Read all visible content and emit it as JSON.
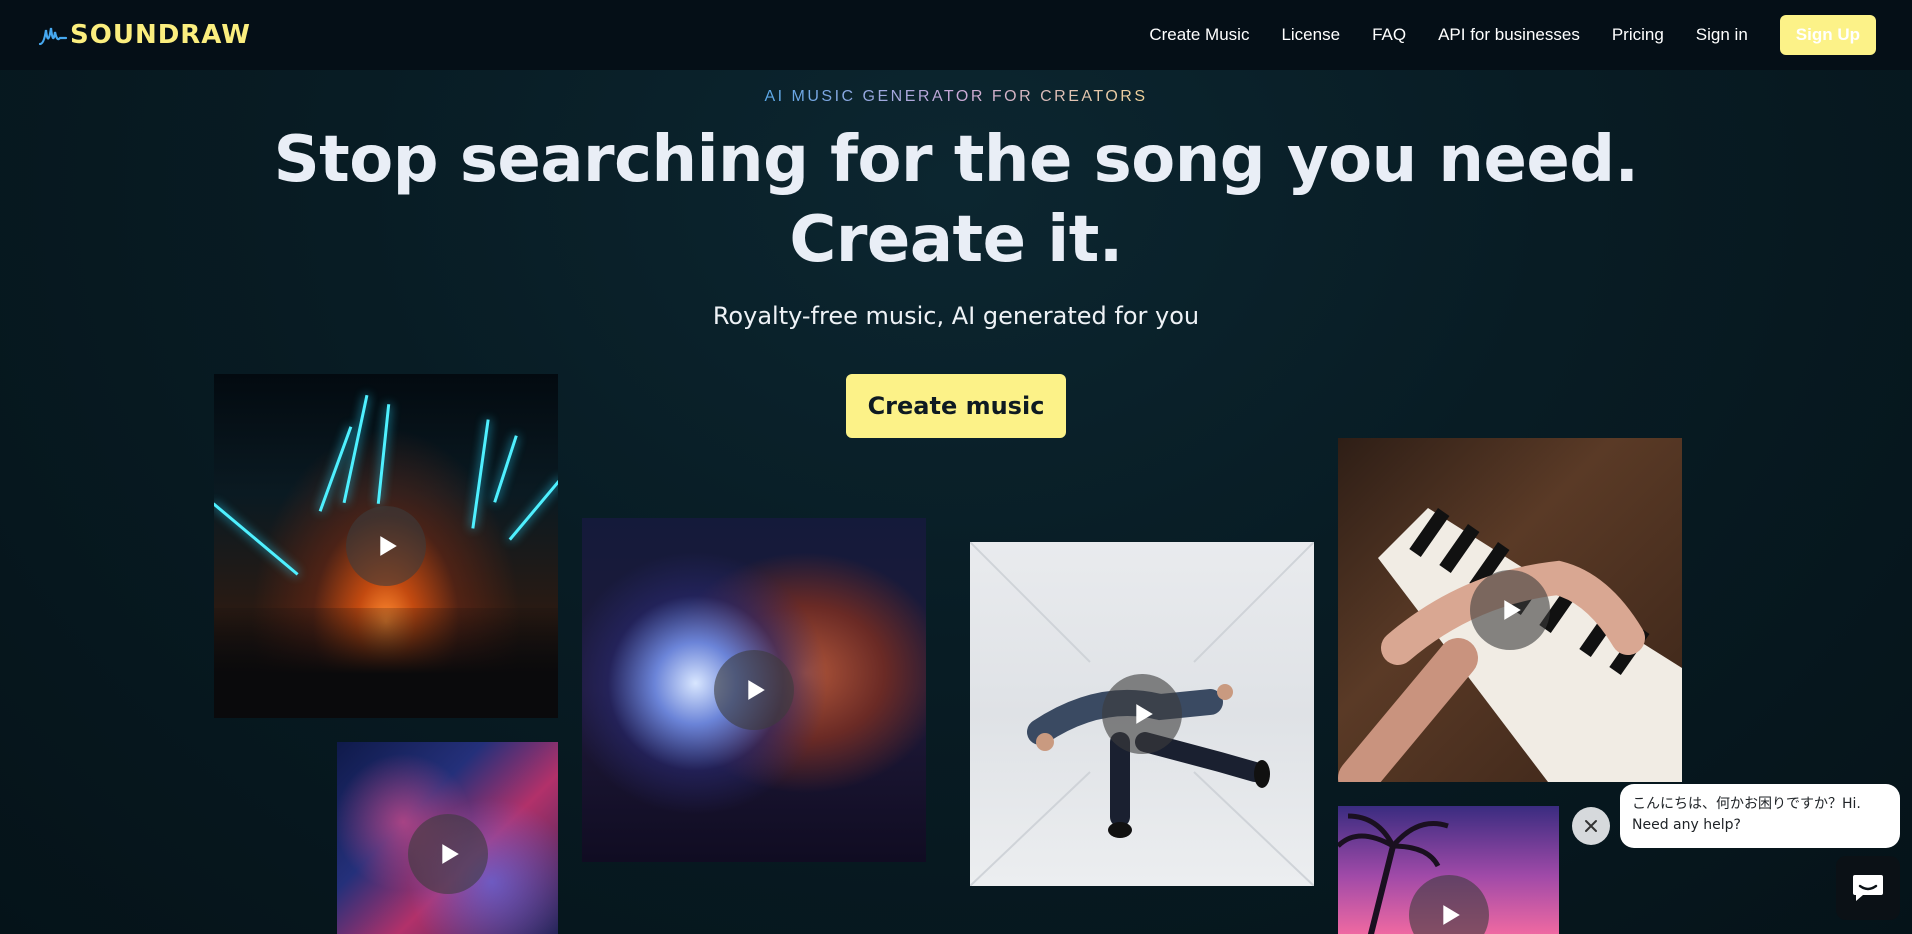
{
  "nav": {
    "logo": "SOUNDRAW",
    "links": [
      "Create Music",
      "License",
      "FAQ",
      "API for businesses",
      "Pricing",
      "Sign in"
    ],
    "signup": "Sign Up"
  },
  "hero": {
    "eyebrow": "AI MUSIC GENERATOR FOR CREATORS",
    "headline_line1": "Stop searching for the song you need.",
    "headline_line2": "Create it.",
    "subhead": "Royalty-free music, AI generated for you",
    "cta": "Create music"
  },
  "tiles": [
    {
      "name": "concert-lights",
      "icon": "play-icon"
    },
    {
      "name": "city-night",
      "icon": "play-icon"
    },
    {
      "name": "disco-ball-woman",
      "icon": "play-icon"
    },
    {
      "name": "dancer",
      "icon": "play-icon"
    },
    {
      "name": "piano-hands",
      "icon": "play-icon"
    },
    {
      "name": "palm-sunset",
      "icon": "play-icon"
    }
  ],
  "chat": {
    "message": "こんにちは、何かお困りですか？Hi. Need any help?",
    "close_icon": "close-icon",
    "launcher_icon": "chat-icon"
  },
  "colors": {
    "accent": "#fcf288",
    "background": "#061820",
    "nav": "#050f17"
  }
}
